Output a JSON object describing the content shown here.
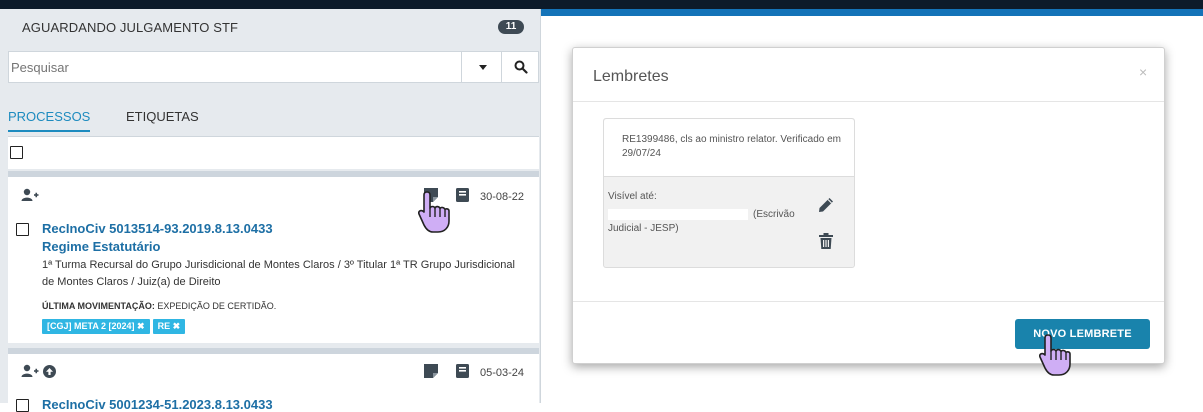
{
  "queue": {
    "title": "AGUARDANDO JULGAMENTO STF",
    "count": "11"
  },
  "search": {
    "placeholder": "Pesquisar"
  },
  "tabs": [
    {
      "label": "PROCESSOS",
      "active": true
    },
    {
      "label": "ETIQUETAS",
      "active": false
    }
  ],
  "processes": [
    {
      "date": "30-08-22",
      "number": "RecInoCiv 5013514-93.2019.8.13.0433",
      "subject": "Regime Estatutário",
      "description": "1ª Turma Recursal do Grupo Jurisdicional de Montes Claros / 3º Titular 1ª TR Grupo Jurisdicional de Montes Claros / Juiz(a) de Direito",
      "last_movement_label": "ÚLTIMA MOVIMENTAÇÃO:",
      "last_movement": "EXPEDIÇÃO DE CERTIDÃO.",
      "tags": [
        "[CGJ] META 2 [2024]",
        "RE"
      ]
    },
    {
      "date": "05-03-24",
      "number": "RecInoCiv 5001234-51.2023.8.13.0433"
    }
  ],
  "modal": {
    "title": "Lembretes",
    "close": "×",
    "reminder": {
      "text": "RE1399486, cls ao ministro relator. Verificado em 29/07/24",
      "visible_until_label": "Visível até:",
      "role_part1": "(Escrivão",
      "role_part2": "Judicial - JESP)"
    },
    "new_button": "NOVO LEMBRETE"
  },
  "colors": {
    "link": "#1d6fa5",
    "accent": "#1d8bbf",
    "tag": "#2fb6e3",
    "button": "#1983ac",
    "header_blue": "#1473b8",
    "cursor": "#c9a6f0"
  }
}
